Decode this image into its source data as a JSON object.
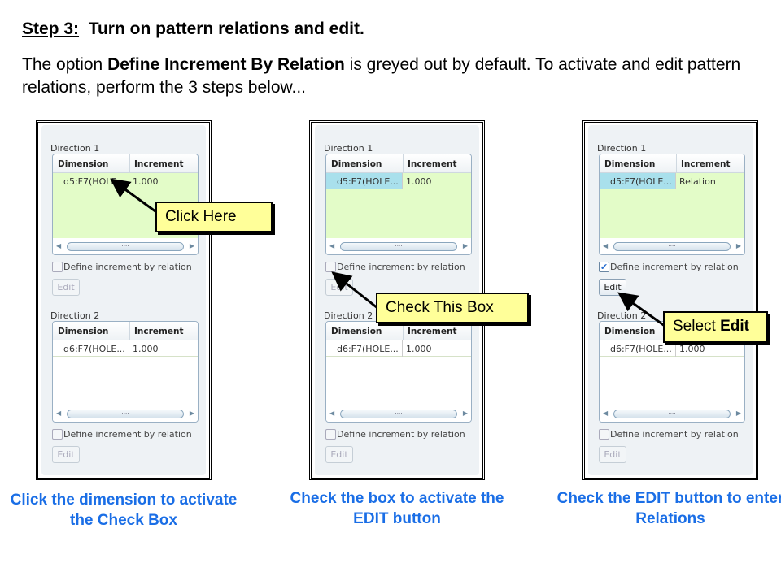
{
  "heading": {
    "step": "Step 3:",
    "text": "Turn on pattern relations and edit."
  },
  "intro": {
    "pre": "The option ",
    "bold": "Define Increment By Relation",
    "post": " is greyed out by default. To activate and edit pattern relations, perform the 3 steps below..."
  },
  "panels": [
    {
      "dir1": "Direction 1",
      "dir2": "Direction 2",
      "col_dimension": "Dimension",
      "col_increment": "Increment",
      "row1_dim": "d5:F7(HOLE...",
      "row1_inc": "1.000",
      "row2_dim": "d6:F7(HOLE...",
      "row2_inc": "1.000",
      "checkbox_label": "Define increment by relation",
      "edit": "Edit",
      "checked1": false,
      "selected": false,
      "edit_enabled": false,
      "caption": "Click the dimension to activate the Check Box"
    },
    {
      "dir1": "Direction 1",
      "dir2": "Direction 2",
      "col_dimension": "Dimension",
      "col_increment": "Increment",
      "row1_dim": "d5:F7(HOLE...",
      "row1_inc": "1.000",
      "row2_dim": "d6:F7(HOLE...",
      "row2_inc": "1.000",
      "checkbox_label": "Define increment by relation",
      "edit": "Edit",
      "checked1": false,
      "selected": true,
      "edit_enabled": false,
      "caption": "Check the box to activate the EDIT button"
    },
    {
      "dir1": "Direction 1",
      "dir2": "Direction 2",
      "col_dimension": "Dimension",
      "col_increment": "Increment",
      "row1_dim": "d5:F7(HOLE...",
      "row1_inc": "Relation",
      "row2_dim": "d6:F7(HOLE...",
      "row2_inc": "1.000",
      "checkbox_label": "Define increment by relation",
      "edit": "Edit",
      "checked1": true,
      "selected": true,
      "edit_enabled": true,
      "caption": "Check the EDIT button to enter Relations"
    }
  ],
  "callouts": {
    "click_here": "Click Here",
    "check_box": "Check This Box",
    "select_pre": "Select ",
    "select_bold": "Edit"
  },
  "colors": {
    "caption": "#1a6ee6",
    "callout": "#ffff99",
    "table_green": "#e3fcc8",
    "selected_cell": "#a9e0ec"
  }
}
